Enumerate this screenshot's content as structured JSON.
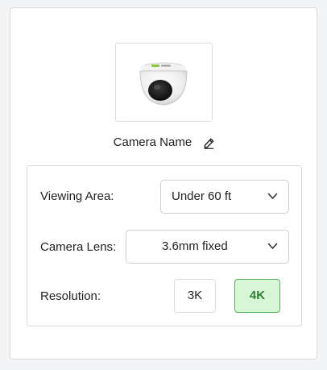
{
  "camera": {
    "name": "Camera Name",
    "image_icon": "dome-camera-icon",
    "edit_icon": "pencil-icon"
  },
  "settings": {
    "viewing_area": {
      "label": "Viewing Area:",
      "value": "Under 60 ft"
    },
    "camera_lens": {
      "label": "Camera Lens:",
      "value": "3.6mm fixed"
    },
    "resolution": {
      "label": "Resolution:",
      "options": [
        "3K",
        "4K"
      ],
      "selected": "4K"
    }
  },
  "colors": {
    "selected_bg": "#d6f6d5",
    "selected_border": "#57b05b",
    "selected_text": "#2e7d32",
    "brand_green": "#8cc63f"
  }
}
